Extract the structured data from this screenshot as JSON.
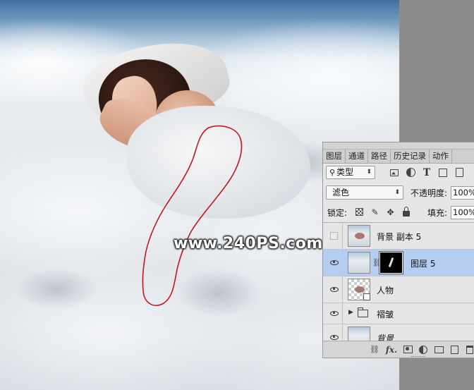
{
  "watermark": "www.240PS.com",
  "colors": {
    "lasso": "#c8141e",
    "panel_bg": "#e6e6e6",
    "selected_row": "#b5cdf0"
  },
  "layers_panel": {
    "tabs": [
      {
        "label": "图层",
        "active": true
      },
      {
        "label": "通道",
        "active": false
      },
      {
        "label": "路径",
        "active": false
      },
      {
        "label": "历史记录",
        "active": false
      },
      {
        "label": "动作",
        "active": false
      }
    ],
    "kind_filter": "类型",
    "filter_icons": [
      "image-filter-icon",
      "adjustment-filter-icon",
      "type-filter-icon",
      "shape-filter-icon",
      "smart-object-filter-icon"
    ],
    "blend_mode": "滤色",
    "opacity_label": "不透明度:",
    "opacity_value": "100%",
    "lock_label": "锁定:",
    "lock_icons": [
      "lock-transparent-icon",
      "lock-paint-icon",
      "lock-position-icon",
      "lock-all-icon"
    ],
    "fill_label": "填充:",
    "fill_value": "100%",
    "layers": [
      {
        "name": "背景 副本 5",
        "visible": false,
        "selected": false,
        "has_mask": false,
        "type": "pixel"
      },
      {
        "name": "图层 5",
        "visible": true,
        "selected": true,
        "has_mask": true,
        "type": "pixel"
      },
      {
        "name": "人物",
        "visible": true,
        "selected": false,
        "has_mask": false,
        "type": "smart-object"
      },
      {
        "name": "褶皱",
        "visible": true,
        "selected": false,
        "has_mask": false,
        "type": "group"
      },
      {
        "name": "背景",
        "visible": true,
        "selected": false,
        "has_mask": false,
        "type": "pixel"
      }
    ],
    "bottom_icons": [
      "link-icon",
      "fx-icon",
      "add-mask-icon",
      "adjustment-layer-icon",
      "new-group-icon",
      "new-layer-icon",
      "delete-icon"
    ]
  }
}
